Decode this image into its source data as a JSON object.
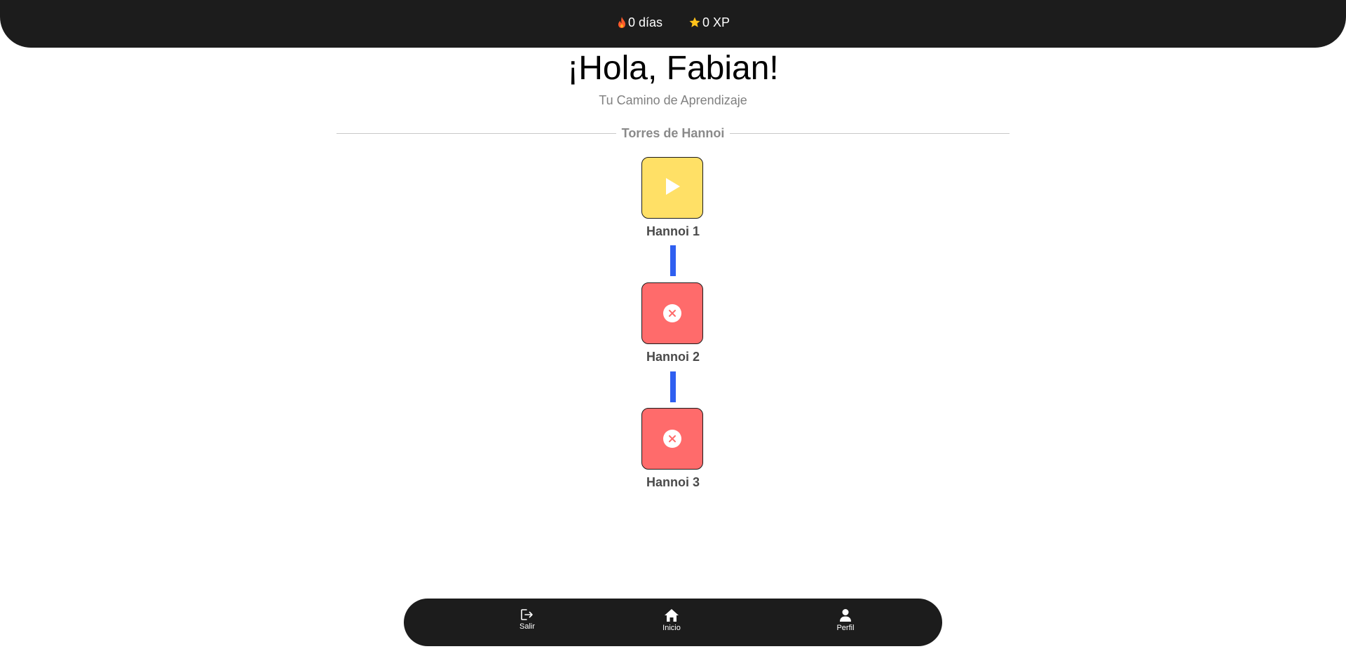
{
  "header": {
    "streak_text": "0 días",
    "streak_icon": "flame-icon",
    "xp_text": "0 XP",
    "xp_icon": "star-icon"
  },
  "greeting": "¡Hola, Fabian!",
  "subtitle": "Tu Camino de Aprendizaje",
  "section": {
    "title": "Torres de Hannoi"
  },
  "levels": [
    {
      "label": "Hannoi 1",
      "state": "active",
      "icon": "play-icon",
      "color": "#ffe066"
    },
    {
      "label": "Hannoi 2",
      "state": "locked",
      "icon": "close-circle-icon",
      "color": "#ff6b6b"
    },
    {
      "label": "Hannoi 3",
      "state": "locked",
      "icon": "close-circle-icon",
      "color": "#ff6b6b"
    }
  ],
  "nav": {
    "salir": {
      "label": "Salir",
      "icon": "logout-icon"
    },
    "inicio": {
      "label": "Inicio",
      "icon": "home-icon"
    },
    "perfil": {
      "label": "Perfil",
      "icon": "user-icon"
    }
  },
  "colors": {
    "bar_background": "#1c1c1c",
    "connector": "#2f5ff0",
    "flame": "#ff5a2a",
    "star": "#ffc21a"
  }
}
